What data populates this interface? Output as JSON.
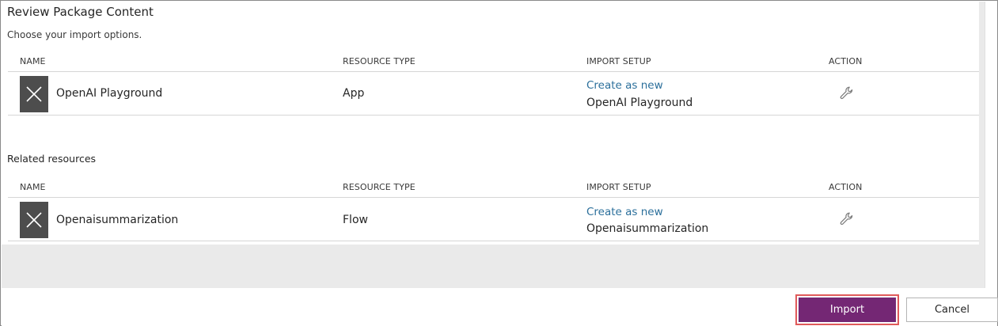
{
  "header": {
    "title": "Review Package Content",
    "subtitle": "Choose your import options."
  },
  "columns": {
    "name": "NAME",
    "resource_type": "RESOURCE TYPE",
    "import_setup": "IMPORT SETUP",
    "action": "ACTION"
  },
  "primary_resources": [
    {
      "name": "OpenAI Playground",
      "resource_type": "App",
      "import_setup_link": "Create as new",
      "import_setup_value": "OpenAI Playground",
      "icon": "close-x-icon",
      "action_icon": "wrench-icon"
    }
  ],
  "related": {
    "title": "Related resources",
    "items": [
      {
        "name": "Openaisummarization",
        "resource_type": "Flow",
        "import_setup_link": "Create as new",
        "import_setup_value": "Openaisummarization",
        "icon": "close-x-icon",
        "action_icon": "wrench-icon"
      }
    ]
  },
  "footer": {
    "import_label": "Import",
    "cancel_label": "Cancel"
  },
  "colors": {
    "primary_button": "#742774",
    "link": "#2b6f9b",
    "highlight_outline": "#e05a5a",
    "tile": "#4d4d4d"
  }
}
